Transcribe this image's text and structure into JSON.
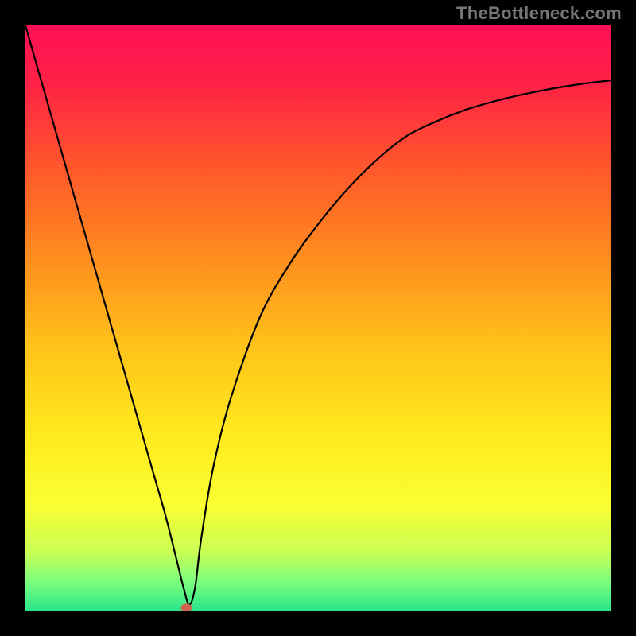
{
  "watermark": "TheBottleneck.com",
  "plot": {
    "inner_x": 32,
    "inner_y": 32,
    "inner_w": 736,
    "inner_h": 736
  },
  "chart_data": {
    "type": "line",
    "title": "",
    "xlabel": "",
    "ylabel": "",
    "xlim": [
      0,
      100
    ],
    "ylim": [
      0,
      100
    ],
    "grid": false,
    "background_gradient": {
      "stops": [
        {
          "offset": 0.0,
          "color": "#ff1056"
        },
        {
          "offset": 0.1,
          "color": "#ff2246"
        },
        {
          "offset": 0.25,
          "color": "#ff5a2a"
        },
        {
          "offset": 0.4,
          "color": "#ff8e1e"
        },
        {
          "offset": 0.55,
          "color": "#ffc31a"
        },
        {
          "offset": 0.7,
          "color": "#ffea1e"
        },
        {
          "offset": 0.82,
          "color": "#faff32"
        },
        {
          "offset": 0.9,
          "color": "#c9ff55"
        },
        {
          "offset": 0.95,
          "color": "#7dff7d"
        },
        {
          "offset": 1.0,
          "color": "#29e58b"
        }
      ]
    },
    "series": [
      {
        "name": "bottleneck-curve",
        "color": "#000000",
        "x": [
          0,
          2,
          4,
          6,
          8,
          10,
          12,
          14,
          16,
          18,
          20,
          22,
          24,
          26,
          27,
          28,
          29,
          30,
          32,
          35,
          40,
          45,
          50,
          55,
          60,
          65,
          70,
          75,
          80,
          85,
          90,
          95,
          100
        ],
        "values": [
          100,
          93,
          86,
          79,
          72,
          65,
          58,
          51,
          44,
          37,
          30,
          23,
          16,
          8,
          4,
          1,
          4,
          12,
          24,
          36,
          50,
          59,
          66,
          72,
          77,
          81,
          83.5,
          85.5,
          87,
          88.2,
          89.2,
          90,
          90.6
        ]
      }
    ],
    "markers": [
      {
        "name": "optimum-dot",
        "x": 27.5,
        "y": 0.5,
        "color": "#d06454",
        "rx": 7,
        "ry": 5
      }
    ]
  }
}
